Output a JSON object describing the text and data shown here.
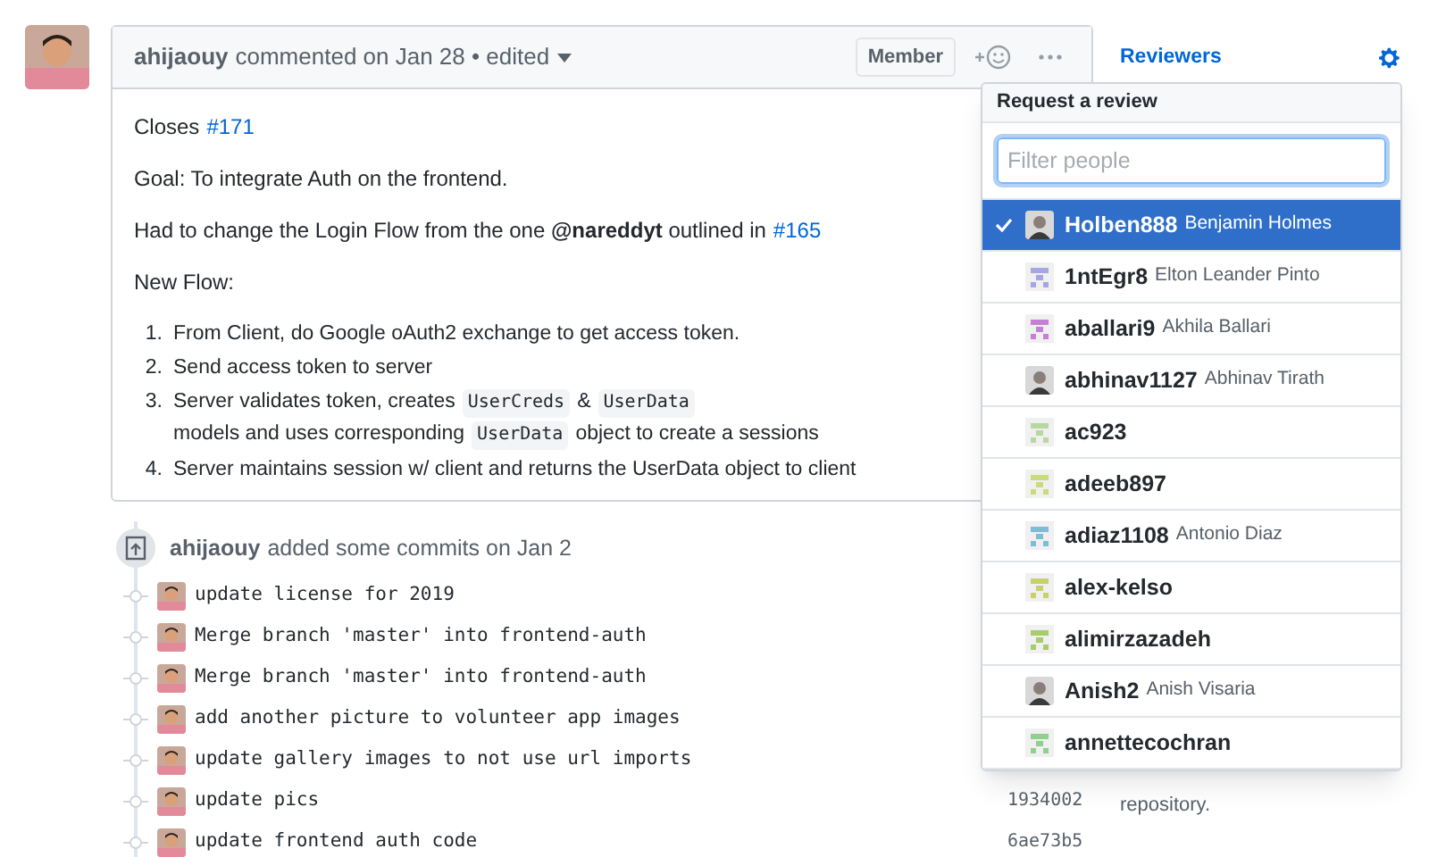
{
  "comment": {
    "author": "ahijaouy",
    "meta": "commented on Jan 28 • edited",
    "badge": "Member",
    "body": [
      {
        "parts": [
          {
            "text": "Closes",
            "link": false
          },
          {
            "text": "#171",
            "link": true
          }
        ]
      },
      {
        "parts": [
          {
            "text": "Goal: To integrate Auth on the frontend.",
            "link": false
          }
        ]
      },
      {
        "parts": [
          {
            "text": "Had to change the Login Flow from the one **@nareddyt** outlined in",
            "link": false
          },
          {
            "text": "#165",
            "link": true
          }
        ]
      },
      {
        "parts": [
          {
            "text": "New Flow:",
            "link": false
          }
        ]
      }
    ],
    "steps": [
      {
        "num": "1.",
        "parts": [
          {
            "text": "From Client, do Google oAuth2 exchange to get access token.",
            "code": false
          }
        ]
      },
      {
        "num": "2.",
        "parts": [
          {
            "text": "Send access token to server",
            "code": false
          }
        ]
      },
      {
        "num": "3.",
        "parts": [
          {
            "text": "Server validates token, creates",
            "code": false
          },
          {
            "text": "UserCreds",
            "code": true
          },
          {
            "text": "&",
            "code": false
          },
          {
            "text": "UserData",
            "code": true
          },
          {
            "text": "models and uses corresponding",
            "code": false
          },
          {
            "text": "UserData",
            "code": true
          },
          {
            "text": "object to create a sessions",
            "code": false
          }
        ]
      },
      {
        "num": "4.",
        "parts": [
          {
            "text": "Server maintains session w/ client and returns the UserData object to client",
            "code": false
          }
        ]
      }
    ]
  },
  "commits_event": {
    "author": "ahijaouy",
    "text": "added some commits on Jan 2"
  },
  "commits": [
    {
      "message": "update license for 2019"
    },
    {
      "message": "Merge branch 'master' into frontend-auth"
    },
    {
      "message": "Merge branch 'master' into frontend-auth"
    },
    {
      "message": "add another picture to volunteer app images"
    },
    {
      "message": "update gallery images to not use url imports"
    },
    {
      "message": "update pics",
      "hash": "1934002"
    },
    {
      "message": "update frontend auth code",
      "hash": "6ae73b5"
    }
  ],
  "sidebar": {
    "reviewers_label": "Reviewers",
    "note": "repository."
  },
  "review_menu": {
    "title": "Request a review",
    "placeholder": "Filter people",
    "people": [
      {
        "login": "Holben888",
        "name": "Benjamin Holmes",
        "selected": true,
        "kind": "photo"
      },
      {
        "login": "1ntEgr8",
        "name": "Elton Leander Pinto",
        "selected": false,
        "kind": "identicon",
        "color": "#a6a6e0"
      },
      {
        "login": "aballari9",
        "name": "Akhila Ballari",
        "selected": false,
        "kind": "identicon",
        "color": "#c77fd6"
      },
      {
        "login": "abhinav1127",
        "name": "Abhinav Tirath",
        "selected": false,
        "kind": "photo"
      },
      {
        "login": "ac923",
        "selected": false,
        "kind": "identicon",
        "color": "#b8d8a0"
      },
      {
        "login": "adeeb897",
        "selected": false,
        "kind": "identicon",
        "color": "#c9dc7a"
      },
      {
        "login": "adiaz1108",
        "name": "Antonio Diaz",
        "selected": false,
        "kind": "identicon",
        "color": "#7fbcd6"
      },
      {
        "login": "alex-kelso",
        "selected": false,
        "kind": "identicon",
        "color": "#c8d06a"
      },
      {
        "login": "alimirzazadeh",
        "selected": false,
        "kind": "identicon",
        "color": "#a8cc6a"
      },
      {
        "login": "Anish2",
        "name": "Anish Visaria",
        "selected": false,
        "kind": "photo"
      },
      {
        "login": "annettecochran",
        "selected": false,
        "kind": "identicon",
        "color": "#8fd08f"
      }
    ]
  }
}
